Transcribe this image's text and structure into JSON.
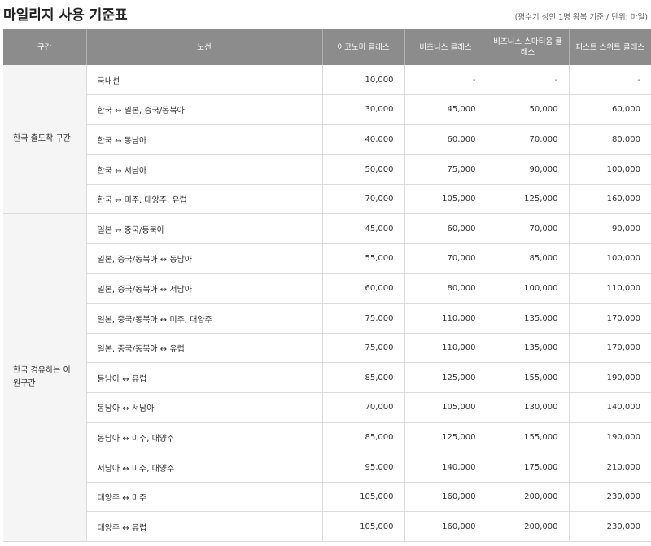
{
  "title": "마일리지 사용 기준표",
  "note": "(평수기 성인 1명 왕복 기준 / 단위: 마일)",
  "columns": [
    "구간",
    "노선",
    "이코노미 클래스",
    "비즈니스 클래스",
    "비즈니스 스마티움 클래스",
    "퍼스트 스위트 클래스"
  ],
  "groups": [
    {
      "region": "한국 출도착 구간",
      "rows": [
        {
          "route": "국내선",
          "values": [
            "10,000",
            "-",
            "-",
            "-"
          ]
        },
        {
          "route": "한국 ↔ 일본, 중국/동북아",
          "values": [
            "30,000",
            "45,000",
            "50,000",
            "60,000"
          ]
        },
        {
          "route": "한국 ↔ 동남아",
          "values": [
            "40,000",
            "60,000",
            "70,000",
            "80,000"
          ]
        },
        {
          "route": "한국 ↔ 서남아",
          "values": [
            "50,000",
            "75,000",
            "90,000",
            "100,000"
          ]
        },
        {
          "route": "한국 ↔ 미주, 대양주, 유럽",
          "values": [
            "70,000",
            "105,000",
            "125,000",
            "160,000"
          ]
        }
      ]
    },
    {
      "region": "한국 경유하는 이원구간",
      "rows": [
        {
          "route": "일본 ↔ 중국/동북아",
          "values": [
            "45,000",
            "60,000",
            "70,000",
            "90,000"
          ]
        },
        {
          "route": "일본, 중국/동북아 ↔ 동남아",
          "values": [
            "55,000",
            "70,000",
            "85,000",
            "100,000"
          ]
        },
        {
          "route": "일본, 중국/동북아 ↔ 서남아",
          "values": [
            "60,000",
            "80,000",
            "100,000",
            "110,000"
          ]
        },
        {
          "route": "일본, 중국/동북아 ↔ 미주, 대양주",
          "values": [
            "75,000",
            "110,000",
            "135,000",
            "170,000"
          ]
        },
        {
          "route": "일본, 중국/동북아 ↔ 유럽",
          "values": [
            "75,000",
            "110,000",
            "135,000",
            "170,000"
          ]
        },
        {
          "route": "동남아 ↔ 유럽",
          "values": [
            "85,000",
            "125,000",
            "155,000",
            "190,000"
          ]
        },
        {
          "route": "동남아 ↔ 서남아",
          "values": [
            "70,000",
            "105,000",
            "130,000",
            "140,000"
          ]
        },
        {
          "route": "동남아 ↔ 미주, 대양주",
          "values": [
            "85,000",
            "125,000",
            "155,000",
            "190,000"
          ]
        },
        {
          "route": "서남아 ↔ 미주, 대양주",
          "values": [
            "95,000",
            "140,000",
            "175,000",
            "210,000"
          ]
        },
        {
          "route": "대양주 ↔ 미주",
          "values": [
            "105,000",
            "160,000",
            "200,000",
            "230,000"
          ]
        },
        {
          "route": "대양주 ↔ 유럽",
          "values": [
            "105,000",
            "160,000",
            "200,000",
            "230,000"
          ]
        }
      ]
    }
  ]
}
